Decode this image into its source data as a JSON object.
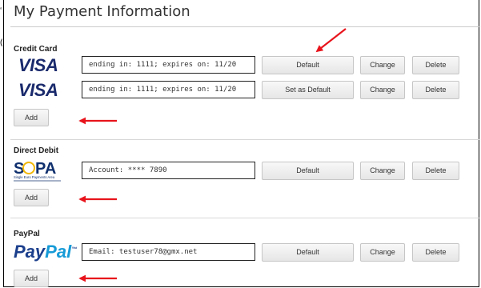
{
  "page": {
    "title": "My Payment Information",
    "margin_glyphs": [
      "‘",
      "("
    ]
  },
  "sections": {
    "credit_card": {
      "label": "Credit Card",
      "rows": [
        {
          "logo": "VISA",
          "field": "ending in: 1111; expires on: 11/20",
          "main_button": "Default",
          "change": "Change",
          "delete": "Delete"
        },
        {
          "logo": "VISA",
          "field": "ending in: 1111; expires on: 11/20",
          "main_button": "Set as Default",
          "change": "Change",
          "delete": "Delete"
        }
      ],
      "add": "Add"
    },
    "direct_debit": {
      "label": "Direct Debit",
      "logo": "SEPA",
      "logo_small": "Single Euro Payments Area",
      "field": "Account: **** 7890",
      "main_button": "Default",
      "change": "Change",
      "delete": "Delete",
      "add": "Add"
    },
    "paypal": {
      "label": "PayPal",
      "logo_pay": "Pay",
      "logo_pal": "Pal",
      "logo_tm": "™",
      "field": "Email: testuser78@gmx.net",
      "main_button": "Default",
      "change": "Change",
      "delete": "Delete",
      "add": "Add"
    }
  },
  "annotations": {
    "arrow_color": "#e8141c"
  }
}
